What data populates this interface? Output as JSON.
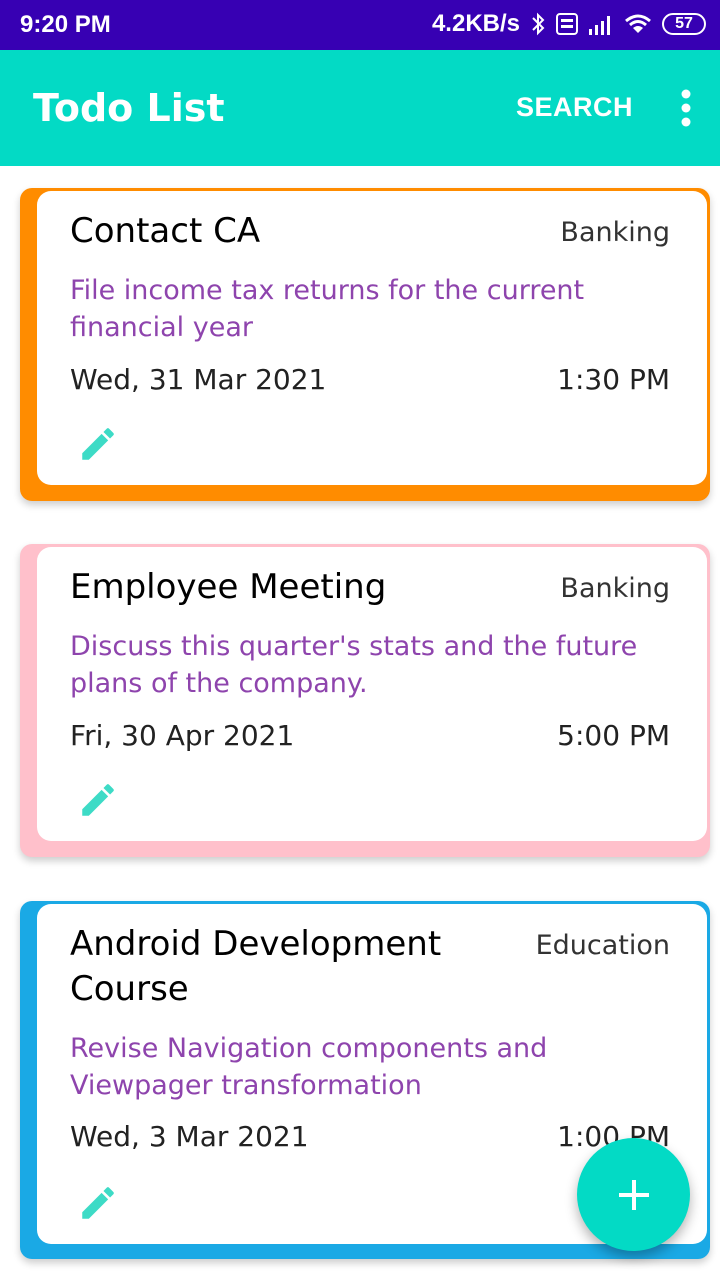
{
  "status_bar": {
    "time": "9:20 PM",
    "network_speed": "4.2KB/s",
    "battery": "57",
    "icons": [
      "bluetooth-icon",
      "volte-icon",
      "signal-icon",
      "wifi-icon",
      "battery-icon"
    ]
  },
  "app_bar": {
    "title": "Todo List",
    "search_label": "SEARCH",
    "menu_icon": "more-vert-icon"
  },
  "colors": {
    "status_bar": "#3700b3",
    "app_bar": "#03dac5",
    "description_text": "#8e44ad",
    "edit_icon": "#3ddbc6"
  },
  "todos": [
    {
      "title": "Contact CA",
      "category": "Banking",
      "description": "File income tax returns for the current financial year",
      "date": "Wed, 31 Mar 2021",
      "time": "1:30 PM",
      "accent_color": "#ff8c00"
    },
    {
      "title": "Employee Meeting",
      "category": "Banking",
      "description": "Discuss this quarter's stats and the future plans of the company.",
      "date": "Fri, 30 Apr 2021",
      "time": "5:00 PM",
      "accent_color": "#ffc0cb"
    },
    {
      "title": "Android Development Course",
      "category": "Education",
      "description": "Revise Navigation components and Viewpager transformation",
      "date": "Wed, 3 Mar 2021",
      "time": "1:00 PM",
      "accent_color": "#1aa9e5"
    }
  ],
  "fab": {
    "icon": "add-icon"
  }
}
